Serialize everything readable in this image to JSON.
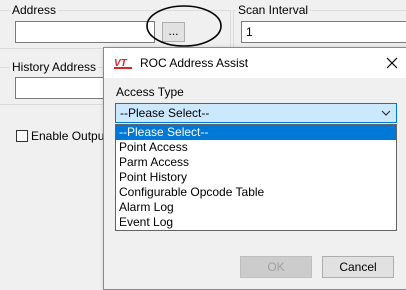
{
  "background_form": {
    "address_label": "Address",
    "address_value": "",
    "browse_button_label": "...",
    "scan_interval_label": "Scan Interval",
    "scan_interval_value": "1",
    "history_address_label": "History Address",
    "enable_output_label": "Enable Output"
  },
  "dialog": {
    "logo_text": "VT",
    "title": "ROC Address Assist",
    "access_type_label": "Access Type",
    "selected_value": "--Please Select--",
    "options": [
      "--Please Select--",
      "Point Access",
      "Parm Access",
      "Point History",
      "Configurable Opcode Table",
      "Alarm Log",
      "Event Log"
    ],
    "ok_label": "OK",
    "cancel_label": "Cancel"
  },
  "colors": {
    "selection_blue": "#0078d7",
    "select_highlight": "#cce8ff",
    "logo_red": "#d9262b"
  }
}
